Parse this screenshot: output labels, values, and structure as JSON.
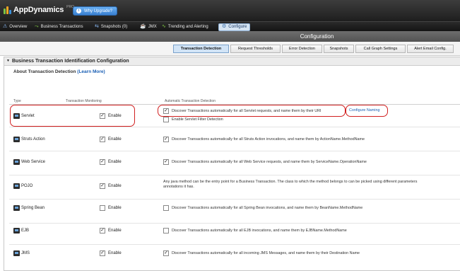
{
  "app": {
    "logo_text": "AppDynamics",
    "logo_tm": "PRO",
    "why_button": "Why Upgrade?"
  },
  "nav": [
    {
      "label": "Overview",
      "icon": "overview-icon"
    },
    {
      "label": "Business Transactions",
      "icon": "transactions-icon"
    },
    {
      "label": "Snapshots (0)",
      "icon": "snapshots-icon"
    },
    {
      "label": "JMX",
      "icon": "jmx-icon"
    },
    {
      "label": "Trending and Alerting",
      "icon": "trending-icon"
    },
    {
      "label": "Configure",
      "icon": "configure-icon"
    }
  ],
  "page_title": "Configuration",
  "tabs": [
    {
      "label": "Transaction Detection",
      "active": true
    },
    {
      "label": "Request Thresholds",
      "active": false
    },
    {
      "label": "Error Detection",
      "active": false
    },
    {
      "label": "Snapshots",
      "active": false
    },
    {
      "label": "Call Graph Settings",
      "active": false
    },
    {
      "label": "Alert Email Config.",
      "active": false
    }
  ],
  "panel": {
    "title": "Business Transaction Identification Configuration",
    "about_label": "About Transaction Detection",
    "learn_more": "(Learn More)"
  },
  "table": {
    "columns": [
      "Type",
      "Transaction Monitoring",
      "Automatic Transaction Detection"
    ],
    "enable_label": "Enable",
    "rows": [
      {
        "type": "Servlet",
        "enabled": true,
        "detect_checked": true,
        "detection": "Discover Transactions automatically for all Servlet requests, and name them by their URI",
        "link": "Configure Naming",
        "extra": "Enable Servlet Filter Detection"
      },
      {
        "type": "Struts Action",
        "enabled": true,
        "detect_checked": true,
        "detection": "Discover Transactions automatically for all Struts Action invocations, and name them by ActionName.MethodName"
      },
      {
        "type": "Web Service",
        "enabled": true,
        "detect_checked": true,
        "detection": "Discover Transactions automatically for all Web Service requests, and name them by ServiceName.OperationName"
      },
      {
        "type": "POJO",
        "enabled": true,
        "detection_line1": "Any java method can be the entry point for a Business Transaction. The class to which the method belongs to can be picked using different parameters",
        "detection_line2": "annotations it has."
      },
      {
        "type": "Spring Bean",
        "enabled": false,
        "detect_checked": false,
        "detection": "Discover Transactions automatically for all Spring Bean invocations, and name them by BeanName.MethodName"
      },
      {
        "type": "EJB",
        "enabled": true,
        "detect_checked": false,
        "detection": "Discover Transactions automatically for all EJB invocations, and name them by EJBName.MethodName"
      },
      {
        "type": "JMS",
        "enabled": true,
        "detect_checked": true,
        "detection": "Discover Transactions automatically for all incoming JMS Messages, and name them by their Destination Name"
      }
    ]
  },
  "colors": {
    "accent": "#1a5fb4",
    "highlight": "#d12020",
    "active_tab": "#d2e4f6"
  }
}
